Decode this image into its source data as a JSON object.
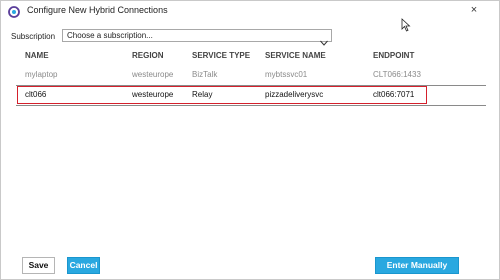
{
  "window": {
    "title": "Configure New Hybrid Connections",
    "close_label": "×"
  },
  "subscription": {
    "label": "Subscription",
    "value": "Choose a subscription..."
  },
  "table": {
    "headers": [
      "NAME",
      "REGION",
      "SERVICE TYPE",
      "SERVICE NAME",
      "ENDPOINT"
    ],
    "rows": [
      {
        "name": "mylaptop",
        "region": "westeurope",
        "service_type": "BizTalk",
        "service_name": "mybtssvc01",
        "endpoint": "CLT066:1433",
        "selected": false
      },
      {
        "name": "clt066",
        "region": "westeurope",
        "service_type": "Relay",
        "service_name": "pizzadeliverysvc",
        "endpoint": "clt066:7071",
        "selected": true
      }
    ]
  },
  "footer": {
    "save_label": "Save",
    "cancel_label": "Cancel",
    "enter_manually_label": "Enter Manually"
  },
  "colors": {
    "accent": "#29a8e0",
    "selection_outline": "#d4202c"
  },
  "icons": {
    "app": "hybrid-connection-icon",
    "close": "close-icon",
    "dropdown": "chevron-down-icon",
    "cursor": "mouse-pointer-icon"
  }
}
